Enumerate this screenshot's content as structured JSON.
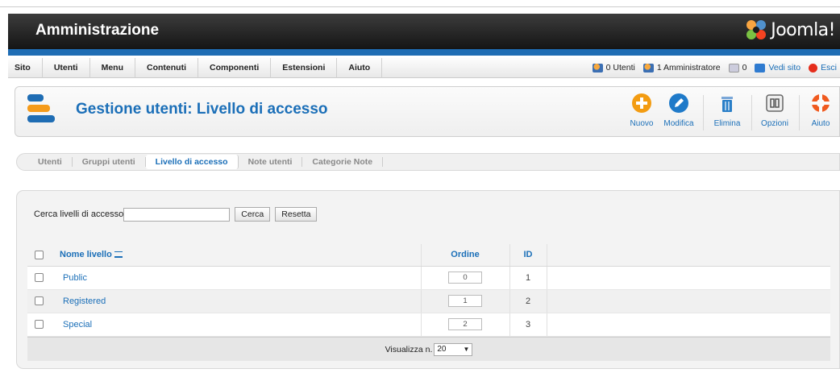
{
  "header": {
    "title": "Amministrazione",
    "brand": "Joomla!"
  },
  "menu": {
    "items": [
      "Sito",
      "Utenti",
      "Menu",
      "Contenuti",
      "Componenti",
      "Estensioni",
      "Aiuto"
    ]
  },
  "status": {
    "users_online": "0 Utenti",
    "admins": "1 Amministratore",
    "messages": "0",
    "view_site": "Vedi sito",
    "logout": "Esci"
  },
  "toolbar": {
    "page_title": "Gestione utenti: Livello di accesso",
    "buttons": {
      "new": "Nuovo",
      "edit": "Modifica",
      "delete": "Elimina",
      "options": "Opzioni",
      "help": "Aiuto"
    },
    "colors": {
      "new": "#f39c12",
      "edit": "#1f7ac9",
      "delete": "#2a7fc8",
      "help": "#f05a1f"
    }
  },
  "subnav": {
    "items": [
      {
        "label": "Utenti",
        "active": false
      },
      {
        "label": "Gruppi utenti",
        "active": false
      },
      {
        "label": "Livello di accesso",
        "active": true
      },
      {
        "label": "Note utenti",
        "active": false
      },
      {
        "label": "Categorie Note",
        "active": false
      }
    ]
  },
  "filter": {
    "label": "Cerca livelli di accesso",
    "value": "",
    "search_button": "Cerca",
    "reset_button": "Resetta"
  },
  "table": {
    "columns": {
      "name": "Nome livello",
      "order": "Ordine",
      "id": "ID"
    },
    "rows": [
      {
        "name": "Public",
        "order": "0",
        "id": "1"
      },
      {
        "name": "Registered",
        "order": "1",
        "id": "2"
      },
      {
        "name": "Special",
        "order": "2",
        "id": "3"
      }
    ]
  },
  "pagination": {
    "label": "Visualizza n.",
    "value": "20"
  }
}
